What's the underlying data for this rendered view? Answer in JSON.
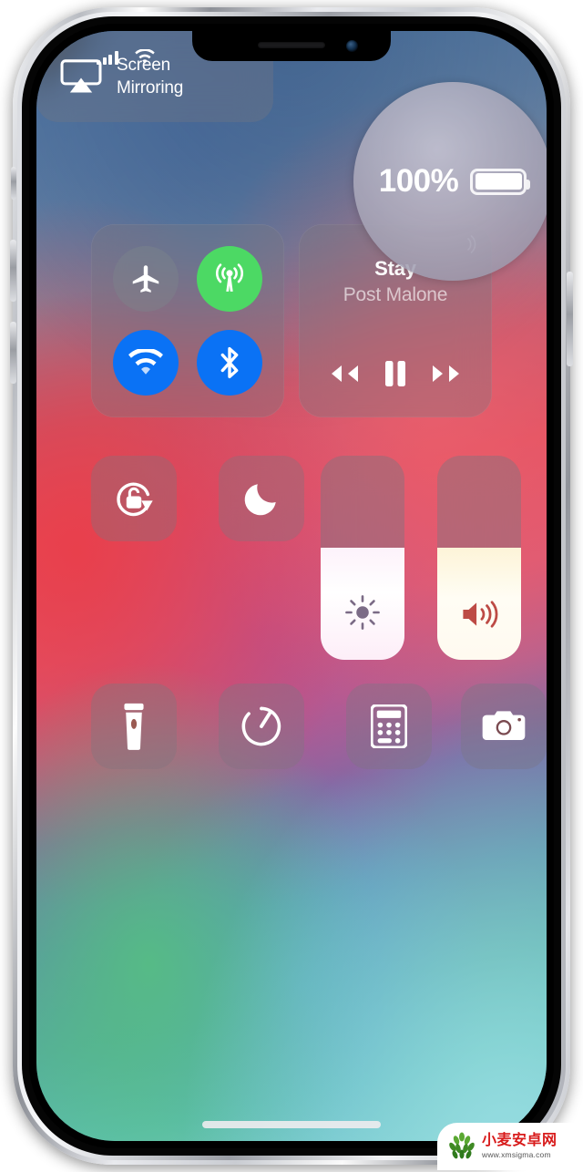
{
  "device": {
    "name": "iphone-x",
    "frame_color": "#c9ccd2",
    "buttons": [
      "mute-switch",
      "volume-up-button",
      "volume-down-button",
      "power-button"
    ],
    "notch": {
      "speaker": "earpiece-speaker",
      "camera": "front-camera"
    }
  },
  "wallpaper": {
    "colors": [
      "#48719f",
      "#e2505f",
      "#b8628f",
      "#5c8fa8",
      "#7fd0cf",
      "#55be82"
    ]
  },
  "status_bar": {
    "signal_bars": 4,
    "signal_icon": "cellular-signal-icon",
    "wifi_icon": "wifi-icon"
  },
  "battery_bubble": {
    "percent_label": "100%",
    "battery_icon": "battery-full-icon",
    "fill_percent": 100
  },
  "control_center": {
    "connectivity": {
      "toggles": [
        {
          "name": "airplane-mode",
          "icon": "airplane-icon",
          "state": "off",
          "color": "#7d888c"
        },
        {
          "name": "cellular-data",
          "icon": "cellular-tower-icon",
          "state": "on",
          "color": "#4cd964"
        },
        {
          "name": "wifi",
          "icon": "wifi-icon",
          "state": "on",
          "color": "#0a72f5"
        },
        {
          "name": "bluetooth",
          "icon": "bluetooth-icon",
          "state": "on",
          "color": "#0a72f5"
        }
      ]
    },
    "music": {
      "title": "Stay",
      "artist": "Post Malone",
      "playback_state": "playing",
      "controls": [
        {
          "name": "rewind",
          "icon": "rewind-icon"
        },
        {
          "name": "pause",
          "icon": "pause-icon"
        },
        {
          "name": "fast-forward",
          "icon": "fast-forward-icon"
        }
      ],
      "airplay_icon": "airplay-audio-icon"
    },
    "rotation_lock": {
      "icon": "rotation-lock-icon",
      "state": "off"
    },
    "do_not_disturb": {
      "icon": "moon-icon",
      "state": "off"
    },
    "screen_mirroring": {
      "label_line1": "Screen",
      "label_line2": "Mirroring",
      "icon": "airplay-screen-icon"
    },
    "brightness_slider": {
      "name": "brightness",
      "icon": "sun-icon",
      "value_percent": 55,
      "fill_color": "#ffffff"
    },
    "volume_slider": {
      "name": "volume",
      "icon": "speaker-wave-icon",
      "value_percent": 55,
      "fill_color": "#fffaf0"
    },
    "shortcuts": [
      {
        "name": "flashlight",
        "icon": "flashlight-icon"
      },
      {
        "name": "timer",
        "icon": "timer-icon"
      },
      {
        "name": "calculator",
        "icon": "calculator-icon"
      },
      {
        "name": "camera",
        "icon": "camera-icon"
      }
    ]
  },
  "home_indicator": {
    "name": "home-indicator"
  },
  "watermark": {
    "cn_text": "小麦安卓网",
    "url": "www.xmsigma.com",
    "logo": "wheat-logo",
    "logo_color": "#5aa832"
  }
}
